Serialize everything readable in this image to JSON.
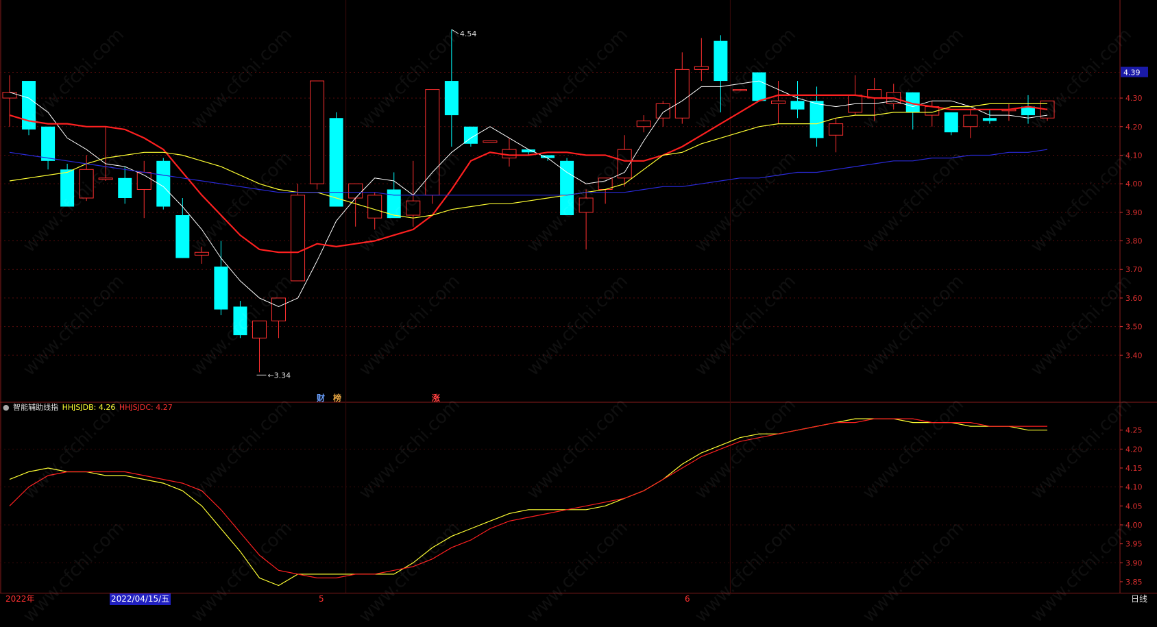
{
  "watermark": "www.cfchi.com",
  "main_price_label": "4.39",
  "annotations": {
    "high_label": "4.54",
    "low_label": "3.34"
  },
  "flags": [
    {
      "text": "财",
      "color": "#6aa0ff"
    },
    {
      "text": "榜",
      "color": "#e0a040"
    },
    {
      "text": "涨",
      "color": "#ff4040"
    }
  ],
  "indicator": {
    "name": "智能辅助线指",
    "s1_label": "HHJSJDB: 4.26",
    "s2_label": "HHJSJDC: 4.27",
    "s1_color": "#ffff33",
    "s2_color": "#ff2020"
  },
  "bottom": {
    "year": "2022年",
    "date": "2022/04/15/五",
    "month5": "5",
    "month6": "6",
    "period": "日线"
  },
  "chart_data": [
    {
      "type": "candlestick",
      "ylim": [
        3.3,
        4.6
      ],
      "yticks": [
        4.3,
        4.2,
        4.1,
        4.0,
        3.9,
        3.8,
        3.7,
        3.6,
        3.5,
        3.4
      ],
      "up_color": "#ff3030",
      "down_color": "#00ffff",
      "candles": [
        {
          "o": 4.3,
          "h": 4.38,
          "l": 4.2,
          "c": 4.32
        },
        {
          "o": 4.36,
          "h": 4.36,
          "l": 4.17,
          "c": 4.19
        },
        {
          "o": 4.2,
          "h": 4.2,
          "l": 4.05,
          "c": 4.08
        },
        {
          "o": 4.05,
          "h": 4.07,
          "l": 3.92,
          "c": 3.92
        },
        {
          "o": 3.95,
          "h": 4.1,
          "l": 3.94,
          "c": 4.05
        },
        {
          "o": 4.02,
          "h": 4.2,
          "l": 4.01,
          "c": 4.02
        },
        {
          "o": 4.02,
          "h": 4.06,
          "l": 3.93,
          "c": 3.95
        },
        {
          "o": 3.98,
          "h": 4.08,
          "l": 3.88,
          "c": 4.04
        },
        {
          "o": 4.08,
          "h": 4.09,
          "l": 3.91,
          "c": 3.92
        },
        {
          "o": 3.89,
          "h": 3.95,
          "l": 3.74,
          "c": 3.74
        },
        {
          "o": 3.75,
          "h": 3.78,
          "l": 3.72,
          "c": 3.76
        },
        {
          "o": 3.71,
          "h": 3.8,
          "l": 3.54,
          "c": 3.56
        },
        {
          "o": 3.57,
          "h": 3.59,
          "l": 3.46,
          "c": 3.47
        },
        {
          "o": 3.46,
          "h": 3.52,
          "l": 3.34,
          "c": 3.52
        },
        {
          "o": 3.52,
          "h": 3.58,
          "l": 3.46,
          "c": 3.6
        },
        {
          "o": 3.66,
          "h": 4.0,
          "l": 3.66,
          "c": 3.96
        },
        {
          "o": 4.0,
          "h": 4.36,
          "l": 3.98,
          "c": 4.36
        },
        {
          "o": 4.23,
          "h": 4.25,
          "l": 3.92,
          "c": 3.92
        },
        {
          "o": 3.95,
          "h": 4.0,
          "l": 3.85,
          "c": 4.0
        },
        {
          "o": 3.88,
          "h": 3.97,
          "l": 3.84,
          "c": 3.96
        },
        {
          "o": 3.98,
          "h": 4.04,
          "l": 3.9,
          "c": 3.88
        },
        {
          "o": 3.89,
          "h": 4.08,
          "l": 3.85,
          "c": 3.94
        },
        {
          "o": 3.96,
          "h": 4.33,
          "l": 3.93,
          "c": 4.33
        },
        {
          "o": 4.36,
          "h": 4.54,
          "l": 4.13,
          "c": 4.24
        },
        {
          "o": 4.2,
          "h": 4.2,
          "l": 4.13,
          "c": 4.14
        },
        {
          "o": 4.15,
          "h": 4.15,
          "l": 4.15,
          "c": 4.15
        },
        {
          "o": 4.09,
          "h": 4.16,
          "l": 4.06,
          "c": 4.12
        },
        {
          "o": 4.12,
          "h": 4.12,
          "l": 4.1,
          "c": 4.11
        },
        {
          "o": 4.1,
          "h": 4.1,
          "l": 4.08,
          "c": 4.09
        },
        {
          "o": 4.08,
          "h": 4.09,
          "l": 3.89,
          "c": 3.89
        },
        {
          "o": 3.9,
          "h": 3.98,
          "l": 3.77,
          "c": 3.95
        },
        {
          "o": 3.98,
          "h": 4.02,
          "l": 3.93,
          "c": 4.02
        },
        {
          "o": 4.02,
          "h": 4.17,
          "l": 3.99,
          "c": 4.12
        },
        {
          "o": 4.2,
          "h": 4.24,
          "l": 4.18,
          "c": 4.22
        },
        {
          "o": 4.23,
          "h": 4.29,
          "l": 4.2,
          "c": 4.28
        },
        {
          "o": 4.23,
          "h": 4.46,
          "l": 4.21,
          "c": 4.4
        },
        {
          "o": 4.4,
          "h": 4.51,
          "l": 4.36,
          "c": 4.41
        },
        {
          "o": 4.5,
          "h": 4.52,
          "l": 4.25,
          "c": 4.36
        },
        {
          "o": 4.33,
          "h": 4.33,
          "l": 4.33,
          "c": 4.33
        },
        {
          "o": 4.39,
          "h": 4.39,
          "l": 4.31,
          "c": 4.29
        },
        {
          "o": 4.28,
          "h": 4.36,
          "l": 4.21,
          "c": 4.29
        },
        {
          "o": 4.29,
          "h": 4.36,
          "l": 4.23,
          "c": 4.26
        },
        {
          "o": 4.29,
          "h": 4.34,
          "l": 4.13,
          "c": 4.16
        },
        {
          "o": 4.17,
          "h": 4.23,
          "l": 4.11,
          "c": 4.21
        },
        {
          "o": 4.25,
          "h": 4.38,
          "l": 4.24,
          "c": 4.31
        },
        {
          "o": 4.3,
          "h": 4.37,
          "l": 4.22,
          "c": 4.33
        },
        {
          "o": 4.28,
          "h": 4.35,
          "l": 4.26,
          "c": 4.32
        },
        {
          "o": 4.32,
          "h": 4.32,
          "l": 4.19,
          "c": 4.25
        },
        {
          "o": 4.24,
          "h": 4.29,
          "l": 4.2,
          "c": 4.27
        },
        {
          "o": 4.25,
          "h": 4.25,
          "l": 4.17,
          "c": 4.18
        },
        {
          "o": 4.2,
          "h": 4.26,
          "l": 4.16,
          "c": 4.24
        },
        {
          "o": 4.23,
          "h": 4.26,
          "l": 4.21,
          "c": 4.22
        },
        {
          "o": 4.26,
          "h": 4.28,
          "l": 4.22,
          "c": 4.26
        },
        {
          "o": 4.27,
          "h": 4.31,
          "l": 4.21,
          "c": 4.24
        },
        {
          "o": 4.23,
          "h": 4.29,
          "l": 4.22,
          "c": 4.29
        }
      ],
      "ma_lines": [
        {
          "color": "#ffffff",
          "values": [
            4.32,
            4.3,
            4.25,
            4.16,
            4.12,
            4.07,
            4.06,
            4.03,
            3.99,
            3.92,
            3.84,
            3.74,
            3.66,
            3.6,
            3.57,
            3.6,
            3.73,
            3.87,
            3.95,
            4.02,
            4.01,
            3.96,
            4.04,
            4.11,
            4.16,
            4.2,
            4.16,
            4.12,
            4.09,
            4.04,
            4.0,
            4.01,
            4.04,
            4.15,
            4.25,
            4.29,
            4.34,
            4.34,
            4.35,
            4.36,
            4.33,
            4.3,
            4.28,
            4.27,
            4.28,
            4.28,
            4.29,
            4.27,
            4.29,
            4.29,
            4.27,
            4.24,
            4.24,
            4.23,
            4.24
          ]
        },
        {
          "color": "#ff2020",
          "values": [
            4.24,
            4.22,
            4.21,
            4.21,
            4.2,
            4.2,
            4.19,
            4.16,
            4.12,
            4.04,
            3.96,
            3.89,
            3.82,
            3.77,
            3.76,
            3.76,
            3.79,
            3.78,
            3.79,
            3.8,
            3.82,
            3.84,
            3.89,
            3.98,
            4.08,
            4.11,
            4.1,
            4.1,
            4.11,
            4.11,
            4.1,
            4.1,
            4.08,
            4.08,
            4.1,
            4.13,
            4.17,
            4.21,
            4.25,
            4.29,
            4.31,
            4.31,
            4.31,
            4.31,
            4.31,
            4.3,
            4.3,
            4.28,
            4.27,
            4.26,
            4.26,
            4.26,
            4.26,
            4.27,
            4.26
          ]
        },
        {
          "color": "#ffff33",
          "values": [
            4.01,
            4.02,
            4.03,
            4.04,
            4.07,
            4.09,
            4.1,
            4.11,
            4.11,
            4.1,
            4.08,
            4.06,
            4.03,
            4.0,
            3.98,
            3.97,
            3.97,
            3.95,
            3.93,
            3.91,
            3.89,
            3.88,
            3.89,
            3.91,
            3.92,
            3.93,
            3.93,
            3.94,
            3.95,
            3.96,
            3.97,
            3.98,
            4.0,
            4.05,
            4.1,
            4.11,
            4.14,
            4.16,
            4.18,
            4.2,
            4.21,
            4.21,
            4.21,
            4.23,
            4.24,
            4.24,
            4.25,
            4.25,
            4.25,
            4.27,
            4.27,
            4.28,
            4.28,
            4.28,
            4.28
          ]
        },
        {
          "color": "#2a2ad8",
          "values": [
            4.11,
            4.1,
            4.09,
            4.08,
            4.07,
            4.06,
            4.05,
            4.04,
            4.03,
            4.02,
            4.01,
            4.0,
            3.99,
            3.98,
            3.97,
            3.97,
            3.97,
            3.97,
            3.97,
            3.97,
            3.96,
            3.96,
            3.96,
            3.96,
            3.96,
            3.96,
            3.96,
            3.96,
            3.96,
            3.96,
            3.97,
            3.97,
            3.97,
            3.98,
            3.99,
            3.99,
            4.0,
            4.01,
            4.02,
            4.02,
            4.03,
            4.04,
            4.04,
            4.05,
            4.06,
            4.07,
            4.08,
            4.08,
            4.09,
            4.09,
            4.1,
            4.1,
            4.11,
            4.11,
            4.12
          ]
        }
      ]
    },
    {
      "type": "line",
      "ylim": [
        3.83,
        4.3
      ],
      "yticks": [
        4.25,
        4.2,
        4.15,
        4.1,
        4.05,
        4.0,
        3.95,
        3.9,
        3.85
      ],
      "series": [
        {
          "name": "HHJSJDB",
          "color": "#ffff33",
          "values": [
            4.12,
            4.14,
            4.15,
            4.14,
            4.14,
            4.13,
            4.13,
            4.12,
            4.11,
            4.09,
            4.05,
            3.99,
            3.93,
            3.86,
            3.84,
            3.87,
            3.87,
            3.87,
            3.87,
            3.87,
            3.87,
            3.9,
            3.94,
            3.97,
            3.99,
            4.01,
            4.03,
            4.04,
            4.04,
            4.04,
            4.04,
            4.05,
            4.07,
            4.09,
            4.12,
            4.16,
            4.19,
            4.21,
            4.23,
            4.24,
            4.24,
            4.25,
            4.26,
            4.27,
            4.28,
            4.28,
            4.28,
            4.27,
            4.27,
            4.27,
            4.26,
            4.26,
            4.26,
            4.25,
            4.25
          ]
        },
        {
          "name": "HHJSJDC",
          "color": "#ff2020",
          "values": [
            4.05,
            4.1,
            4.13,
            4.14,
            4.14,
            4.14,
            4.14,
            4.13,
            4.12,
            4.11,
            4.09,
            4.04,
            3.98,
            3.92,
            3.88,
            3.87,
            3.86,
            3.86,
            3.87,
            3.87,
            3.88,
            3.89,
            3.91,
            3.94,
            3.96,
            3.99,
            4.01,
            4.02,
            4.03,
            4.04,
            4.05,
            4.06,
            4.07,
            4.09,
            4.12,
            4.15,
            4.18,
            4.2,
            4.22,
            4.23,
            4.24,
            4.25,
            4.26,
            4.27,
            4.27,
            4.28,
            4.28,
            4.28,
            4.27,
            4.27,
            4.27,
            4.26,
            4.26,
            4.26,
            4.26
          ]
        }
      ]
    }
  ]
}
